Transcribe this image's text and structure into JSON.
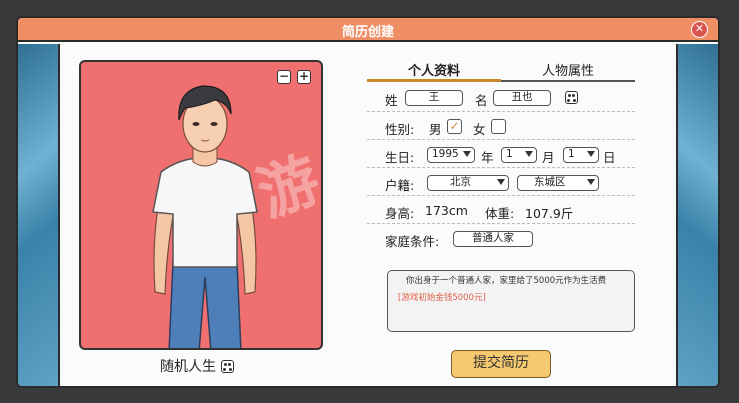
{
  "window": {
    "title": "简历创建"
  },
  "portrait": {
    "zoom_out": "−",
    "zoom_in": "+",
    "random_label": "随机人生"
  },
  "tabs": [
    {
      "label": "个人资料"
    },
    {
      "label": "人物属性"
    }
  ],
  "form": {
    "surname_label": "姓",
    "surname_value": "王",
    "name_label": "名",
    "name_value": "丑也",
    "gender_label": "性别:",
    "male_label": "男",
    "female_label": "女",
    "birthday_label": "生日:",
    "year_value": "1995",
    "year_unit": "年",
    "month_value": "1",
    "month_unit": "月",
    "day_value": "1",
    "day_unit": "日",
    "hukou_label": "户籍:",
    "province_value": "北京",
    "district_value": "东城区",
    "height_label": "身高:",
    "height_value": "173cm",
    "weight_label": "体重:",
    "weight_value": "107.9斤",
    "family_label": "家庭条件:",
    "family_value": "普通人家"
  },
  "description": {
    "text": "你出身于一个普通人家，家里给了5000元作为生活费",
    "bonus": "[游戏初始金钱5000元]"
  },
  "submit": {
    "label": "提交简历"
  },
  "watermark": "游"
}
